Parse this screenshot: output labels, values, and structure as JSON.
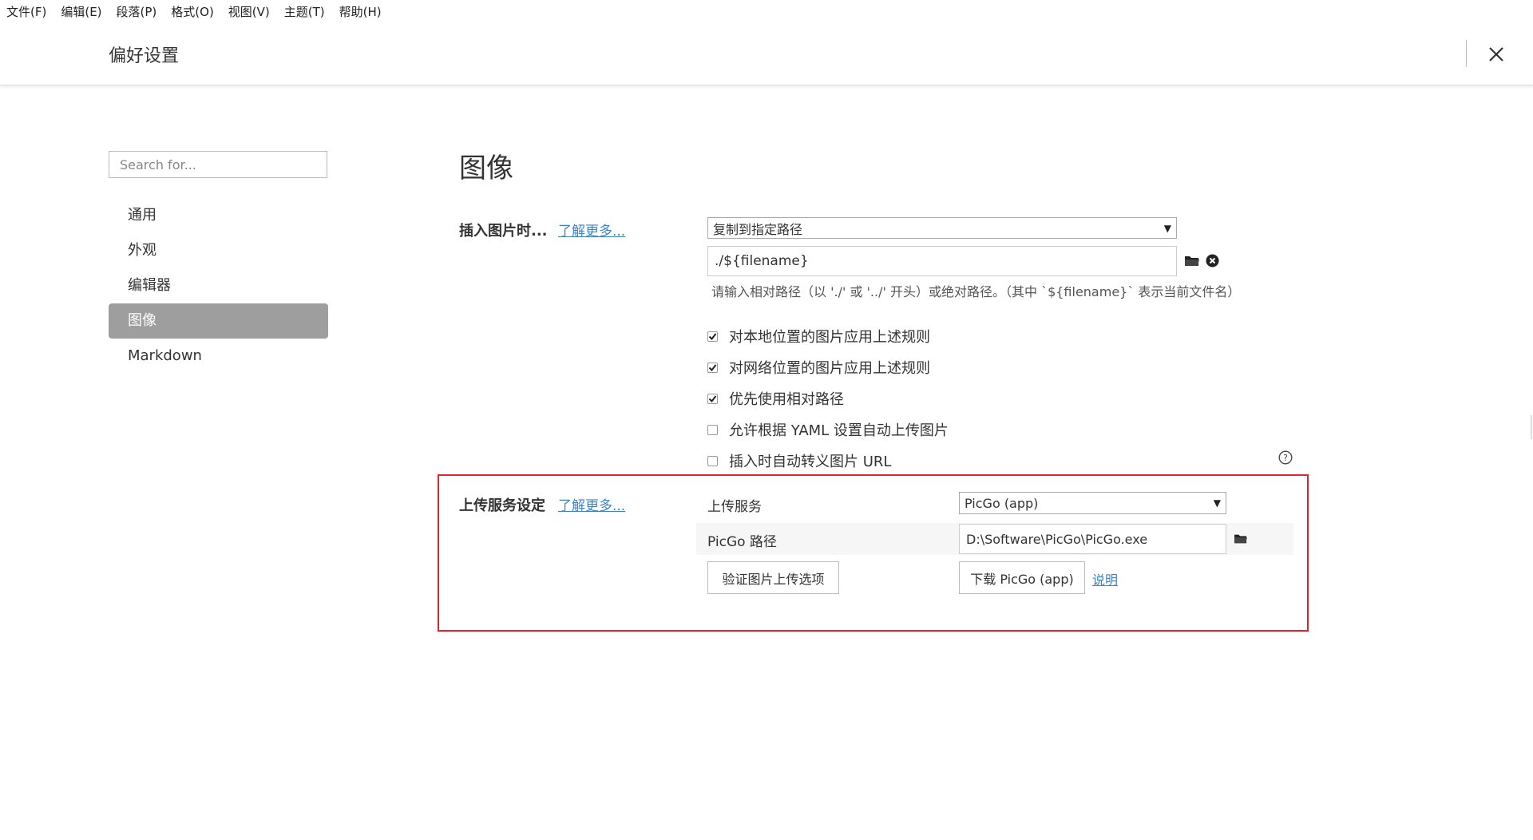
{
  "menu": [
    "文件(F)",
    "编辑(E)",
    "段落(P)",
    "格式(O)",
    "视图(V)",
    "主题(T)",
    "帮助(H)"
  ],
  "header": {
    "title": "偏好设置"
  },
  "search": {
    "placeholder": "Search for..."
  },
  "nav": [
    {
      "label": "通用",
      "active": false
    },
    {
      "label": "外观",
      "active": false
    },
    {
      "label": "编辑器",
      "active": false
    },
    {
      "label": "图像",
      "active": true
    },
    {
      "label": "Markdown",
      "active": false
    }
  ],
  "main": {
    "title": "图像",
    "insert": {
      "label": "插入图片时...",
      "learn_more": "了解更多...",
      "action_select": "复制到指定路径",
      "path_value": "./${filename}",
      "hint": "请输入相对路径（以 './' 或 '../' 开头）或绝对路径。（其中 `${filename}` 表示当前文件名）"
    },
    "checkboxes": [
      {
        "label": "对本地位置的图片应用上述规则",
        "checked": true
      },
      {
        "label": "对网络位置的图片应用上述规则",
        "checked": true
      },
      {
        "label": "优先使用相对路径",
        "checked": true
      },
      {
        "label": "允许根据 YAML 设置自动上传图片",
        "checked": false
      },
      {
        "label": "插入时自动转义图片 URL",
        "checked": false
      }
    ],
    "upload": {
      "label": "上传服务设定",
      "learn_more": "了解更多...",
      "service_label": "上传服务",
      "service_value": "PicGo (app)",
      "path_label": "PicGo 路径",
      "path_value": "D:\\Software\\PicGo\\PicGo.exe",
      "verify_button": "验证图片上传选项",
      "download_button": "下载 PicGo (app)",
      "help_link": "说明"
    }
  },
  "colors": {
    "accent_link": "#3f83c7",
    "active_nav_bg": "#9e9e9e",
    "highlight_border": "#e0242b"
  }
}
